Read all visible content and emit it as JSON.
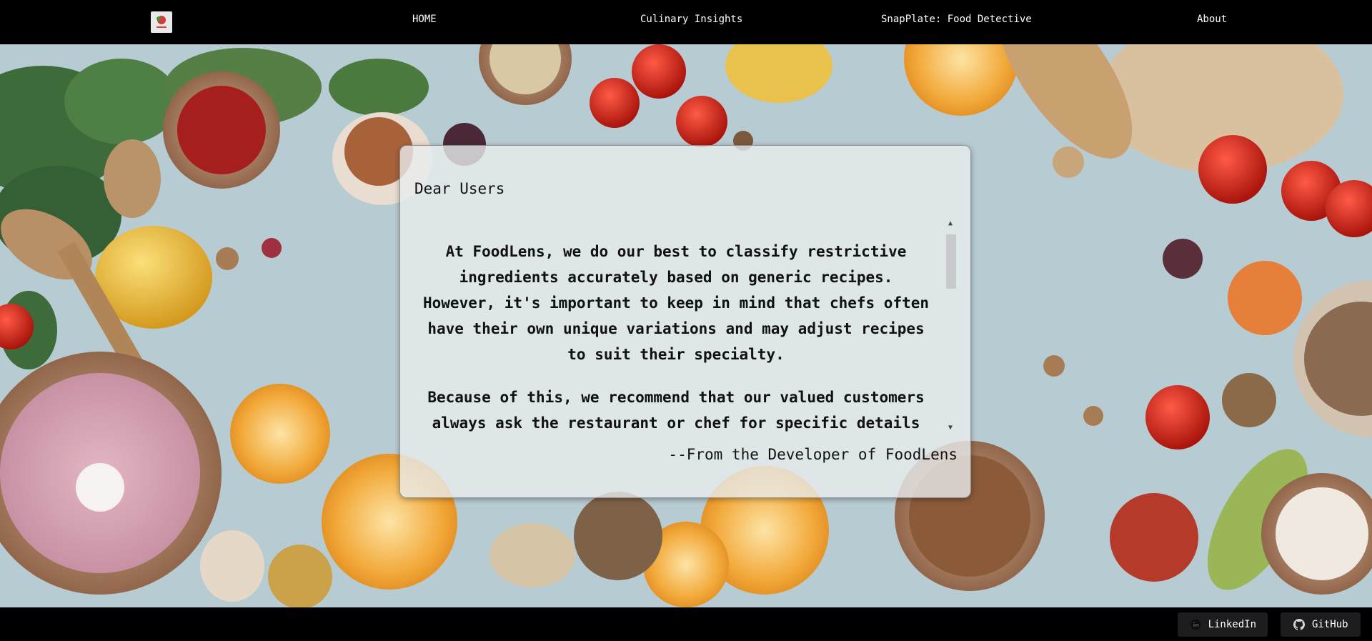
{
  "nav": {
    "logo": "FoodLens",
    "links": [
      {
        "label": "HOME"
      },
      {
        "label": "Culinary Insights"
      },
      {
        "label": "SnapPlate: Food Detective"
      },
      {
        "label": "About"
      }
    ]
  },
  "notice": {
    "title": "Dear Users",
    "paragraphs": [
      "At FoodLens, we do our best to classify restrictive ingredients accurately based on generic recipes. However, it's important to keep in mind that chefs often have their own unique variations and may adjust recipes to suit their specialty.",
      "Because of this, we recommend that our valued customers always ask the restaurant or chef for specific details"
    ],
    "signature": "--From the Developer of FoodLens",
    "scroll_position": 0.0
  },
  "footer": {
    "links": [
      {
        "label": "LinkedIn",
        "icon": "linkedin-icon"
      },
      {
        "label": "GitHub",
        "icon": "github-icon"
      }
    ]
  },
  "colors": {
    "nav_bg": "#000000",
    "card_bg": "#e8ecee",
    "hero_bg": "#b9ccd3"
  }
}
